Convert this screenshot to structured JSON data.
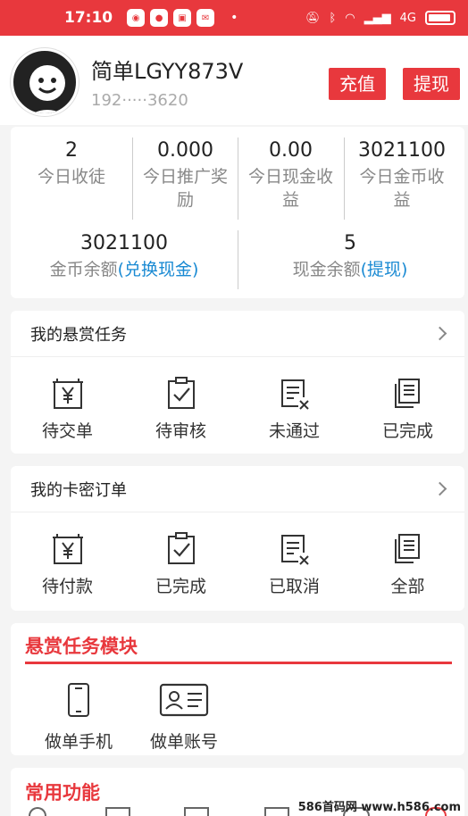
{
  "status": {
    "time": "17:10",
    "dot": "•",
    "network": "4G"
  },
  "profile": {
    "username": "简单LGYY873V",
    "phone": "192·····3620",
    "recharge": "充值",
    "withdraw": "提现"
  },
  "stats": {
    "disciples": {
      "value": "2",
      "label": "今日收徒"
    },
    "promo": {
      "value": "0.000",
      "label1": "今日推广奖",
      "label2": "励"
    },
    "cash": {
      "value": "0.00",
      "label1": "今日现金收",
      "label2": "益"
    },
    "coins": {
      "value": "3021100",
      "label1": "今日金币收",
      "label2": "益"
    },
    "coin_balance": {
      "value": "3021100",
      "label": "金币余额",
      "link": "(兑换现金)"
    },
    "cash_balance": {
      "value": "5",
      "label": "现金余额",
      "link": "(提现)"
    }
  },
  "tasks": {
    "title": "我的悬赏任务",
    "items": [
      {
        "label": "待交单",
        "icon": "yen-document-icon"
      },
      {
        "label": "待审核",
        "icon": "clipboard-check-icon"
      },
      {
        "label": "未通过",
        "icon": "document-x-icon"
      },
      {
        "label": "已完成",
        "icon": "copy-documents-icon"
      }
    ]
  },
  "orders": {
    "title": "我的卡密订单",
    "items": [
      {
        "label": "待付款",
        "icon": "yen-document-icon"
      },
      {
        "label": "已完成",
        "icon": "clipboard-check-icon"
      },
      {
        "label": "已取消",
        "icon": "document-x-icon"
      },
      {
        "label": "全部",
        "icon": "copy-documents-icon"
      }
    ]
  },
  "module": {
    "title": "悬赏任务模块",
    "items": [
      {
        "label": "做单手机",
        "icon": "phone-icon"
      },
      {
        "label": "做单账号",
        "icon": "id-card-icon"
      }
    ]
  },
  "common": {
    "title": "常用功能"
  },
  "watermark": "586首码网 www.h586.com",
  "colors": {
    "accent": "#e8383d",
    "link": "#1a8ad3"
  }
}
